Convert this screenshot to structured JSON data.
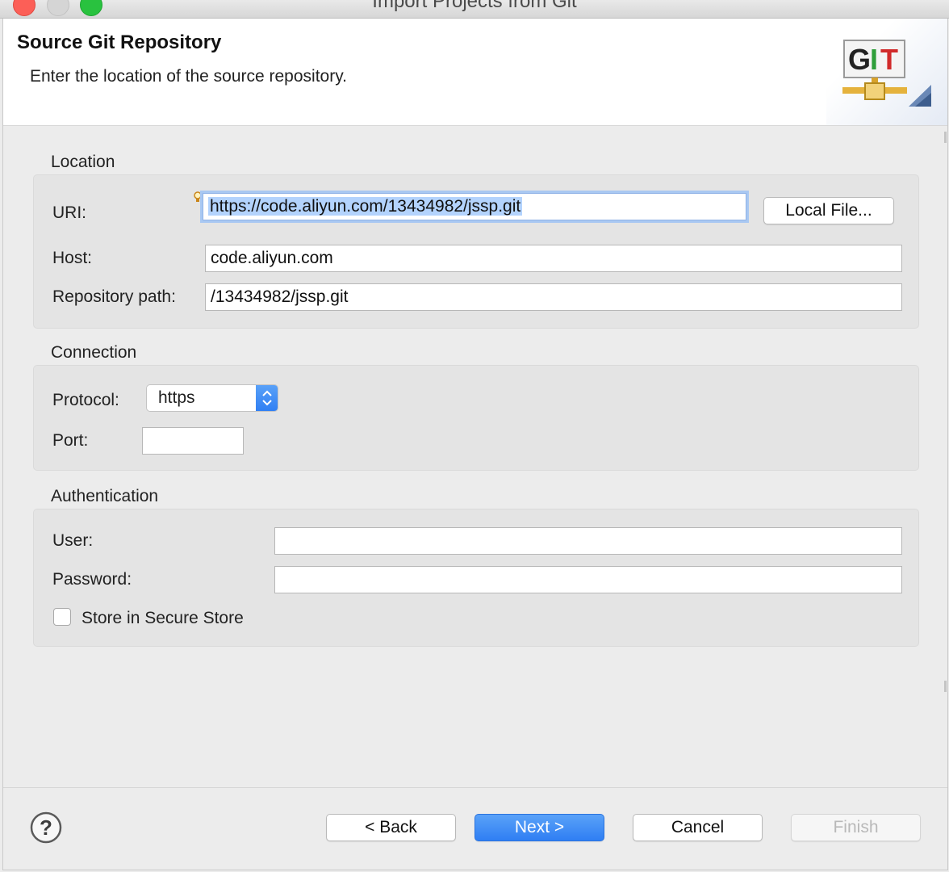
{
  "window": {
    "title": "Import Projects from Git"
  },
  "header": {
    "title": "Source Git Repository",
    "description": "Enter the location of the source repository.",
    "logo_text": "GIT"
  },
  "location": {
    "section_label": "Location",
    "uri_label": "URI:",
    "uri_value": "https://code.aliyun.com/13434982/jssp.git",
    "local_file_button": "Local File...",
    "host_label": "Host:",
    "host_value": "code.aliyun.com",
    "repo_path_label": "Repository path:",
    "repo_path_value": "/13434982/jssp.git"
  },
  "connection": {
    "section_label": "Connection",
    "protocol_label": "Protocol:",
    "protocol_value": "https",
    "port_label": "Port:",
    "port_value": ""
  },
  "authentication": {
    "section_label": "Authentication",
    "user_label": "User:",
    "user_value": "",
    "password_label": "Password:",
    "password_value": "",
    "store_label": "Store in Secure Store",
    "store_checked": false
  },
  "footer": {
    "back_label": "< Back",
    "next_label": "Next >",
    "cancel_label": "Cancel",
    "finish_label": "Finish"
  },
  "colors": {
    "primary_button": "#2f7ef3",
    "selection": "#b3d3fd",
    "git_green": "#2e9e3a",
    "git_red": "#d12a2a"
  },
  "icons": {
    "help": "help-icon",
    "select_arrows": "chevron-updown-icon",
    "content_assist": "lightbulb-icon"
  }
}
